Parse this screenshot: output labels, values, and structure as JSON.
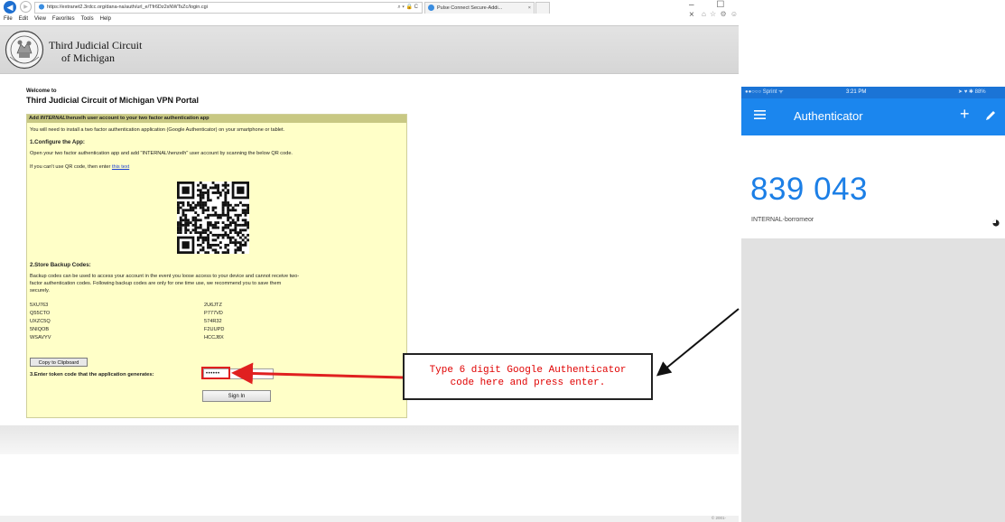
{
  "browser": {
    "url": "https://extranet2.3rdcc.org/dana-na/auth/url_e/Tfr6Dz2sNWTsZc/login.cgi",
    "url_tools": "⌕ ▾ 🔒 C",
    "tab_title": "Pulse Connect Secure-Addi...",
    "tab_close": "×",
    "window_controls": "– ☐ ×",
    "toolbar_icons": "⌂ ☆ ⚙ ☺",
    "menu": [
      "File",
      "Edit",
      "View",
      "Favorites",
      "Tools",
      "Help"
    ]
  },
  "header": {
    "line1": "Third Judicial Circuit",
    "line2": "of Michigan",
    "seal_text": "MICHIGAN"
  },
  "portal": {
    "welcome": "Welcome to",
    "title": "Third Judicial Circuit of Michigan VPN Portal",
    "panel_head_pre": "Add ",
    "panel_head_em": "INTERNAL",
    "panel_head_post": "\\henzelh user account to your two factor authentication app",
    "intro": "You will need to install a two factor authentication application (Google Authenticator) on your smartphone or tablet.",
    "step1": "1.Configure the App:",
    "step1_text": "Open your two factor authentication app and add \"INTERNAL\\henzelh\" user account by scanning the below QR code.",
    "qr_fallback_pre": "If you can't use QR code, then enter ",
    "qr_fallback_link": "this text",
    "step2": "2.Store Backup Codes:",
    "backup_text_1": "Backup codes can be used to access your account in the event you loose access to your device and cannot receive two-",
    "backup_text_2": "factor authentication codes. Following backup codes are only for one time use, we recommend you to save them",
    "backup_text_3": "securely.",
    "codes_left": [
      "5XU763",
      "Q55CTO",
      "UXZC5Q",
      "5NIQOB",
      "WSAVYV"
    ],
    "codes_right": [
      "2U6JTZ",
      "P777VD",
      "574R32",
      "F2UUPD",
      "HCCJ8X"
    ],
    "copy_button": "Copy to Clipboard",
    "step3": "3.Enter token code that the application generates:",
    "token_value": "••••••",
    "token_clear": "×",
    "signin_button": "Sign In"
  },
  "footer": {
    "copyright": "© 2001-"
  },
  "callout": {
    "line1": "Type 6 digit Google Authenticator",
    "line2": "code here and press enter.",
    "color": "#e00000"
  },
  "phone": {
    "carrier": "●●○○○ Sprint ᯤ",
    "time": "3:21 PM",
    "status_right": "➤ ♥ ✱ 88%",
    "app_name": "Authenticator",
    "plus": "+",
    "code": "839 043",
    "account": "INTERNAL-borromeor",
    "accent_color": "#1b86ee"
  }
}
